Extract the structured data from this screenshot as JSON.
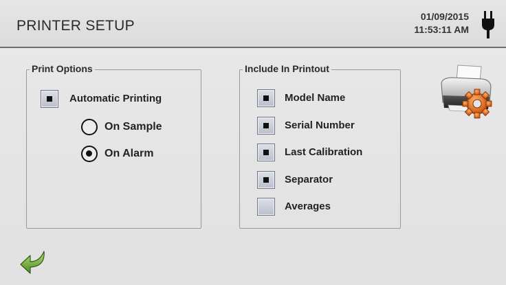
{
  "header": {
    "title": "PRINTER SETUP",
    "date": "01/09/2015",
    "time": "11:53:11 AM",
    "power_icon": "plug-icon"
  },
  "print_options": {
    "legend": "Print Options",
    "automatic_printing": {
      "label": "Automatic Printing",
      "checked": true
    },
    "radios": [
      {
        "label": "On Sample",
        "selected": false
      },
      {
        "label": "On Alarm",
        "selected": true
      }
    ]
  },
  "include_in_printout": {
    "legend": "Include In Printout",
    "items": [
      {
        "label": "Model Name",
        "checked": true
      },
      {
        "label": "Serial Number",
        "checked": true
      },
      {
        "label": "Last Calibration",
        "checked": true
      },
      {
        "label": "Separator",
        "checked": true
      },
      {
        "label": "Averages",
        "checked": false
      }
    ]
  },
  "icons": {
    "printer": "printer-settings-icon",
    "back": "back-arrow-icon"
  },
  "colors": {
    "background": "#e4e4e4",
    "checkbox": "#c8ccd6",
    "back_arrow": "#7db34a",
    "gear": "#d9631a"
  }
}
